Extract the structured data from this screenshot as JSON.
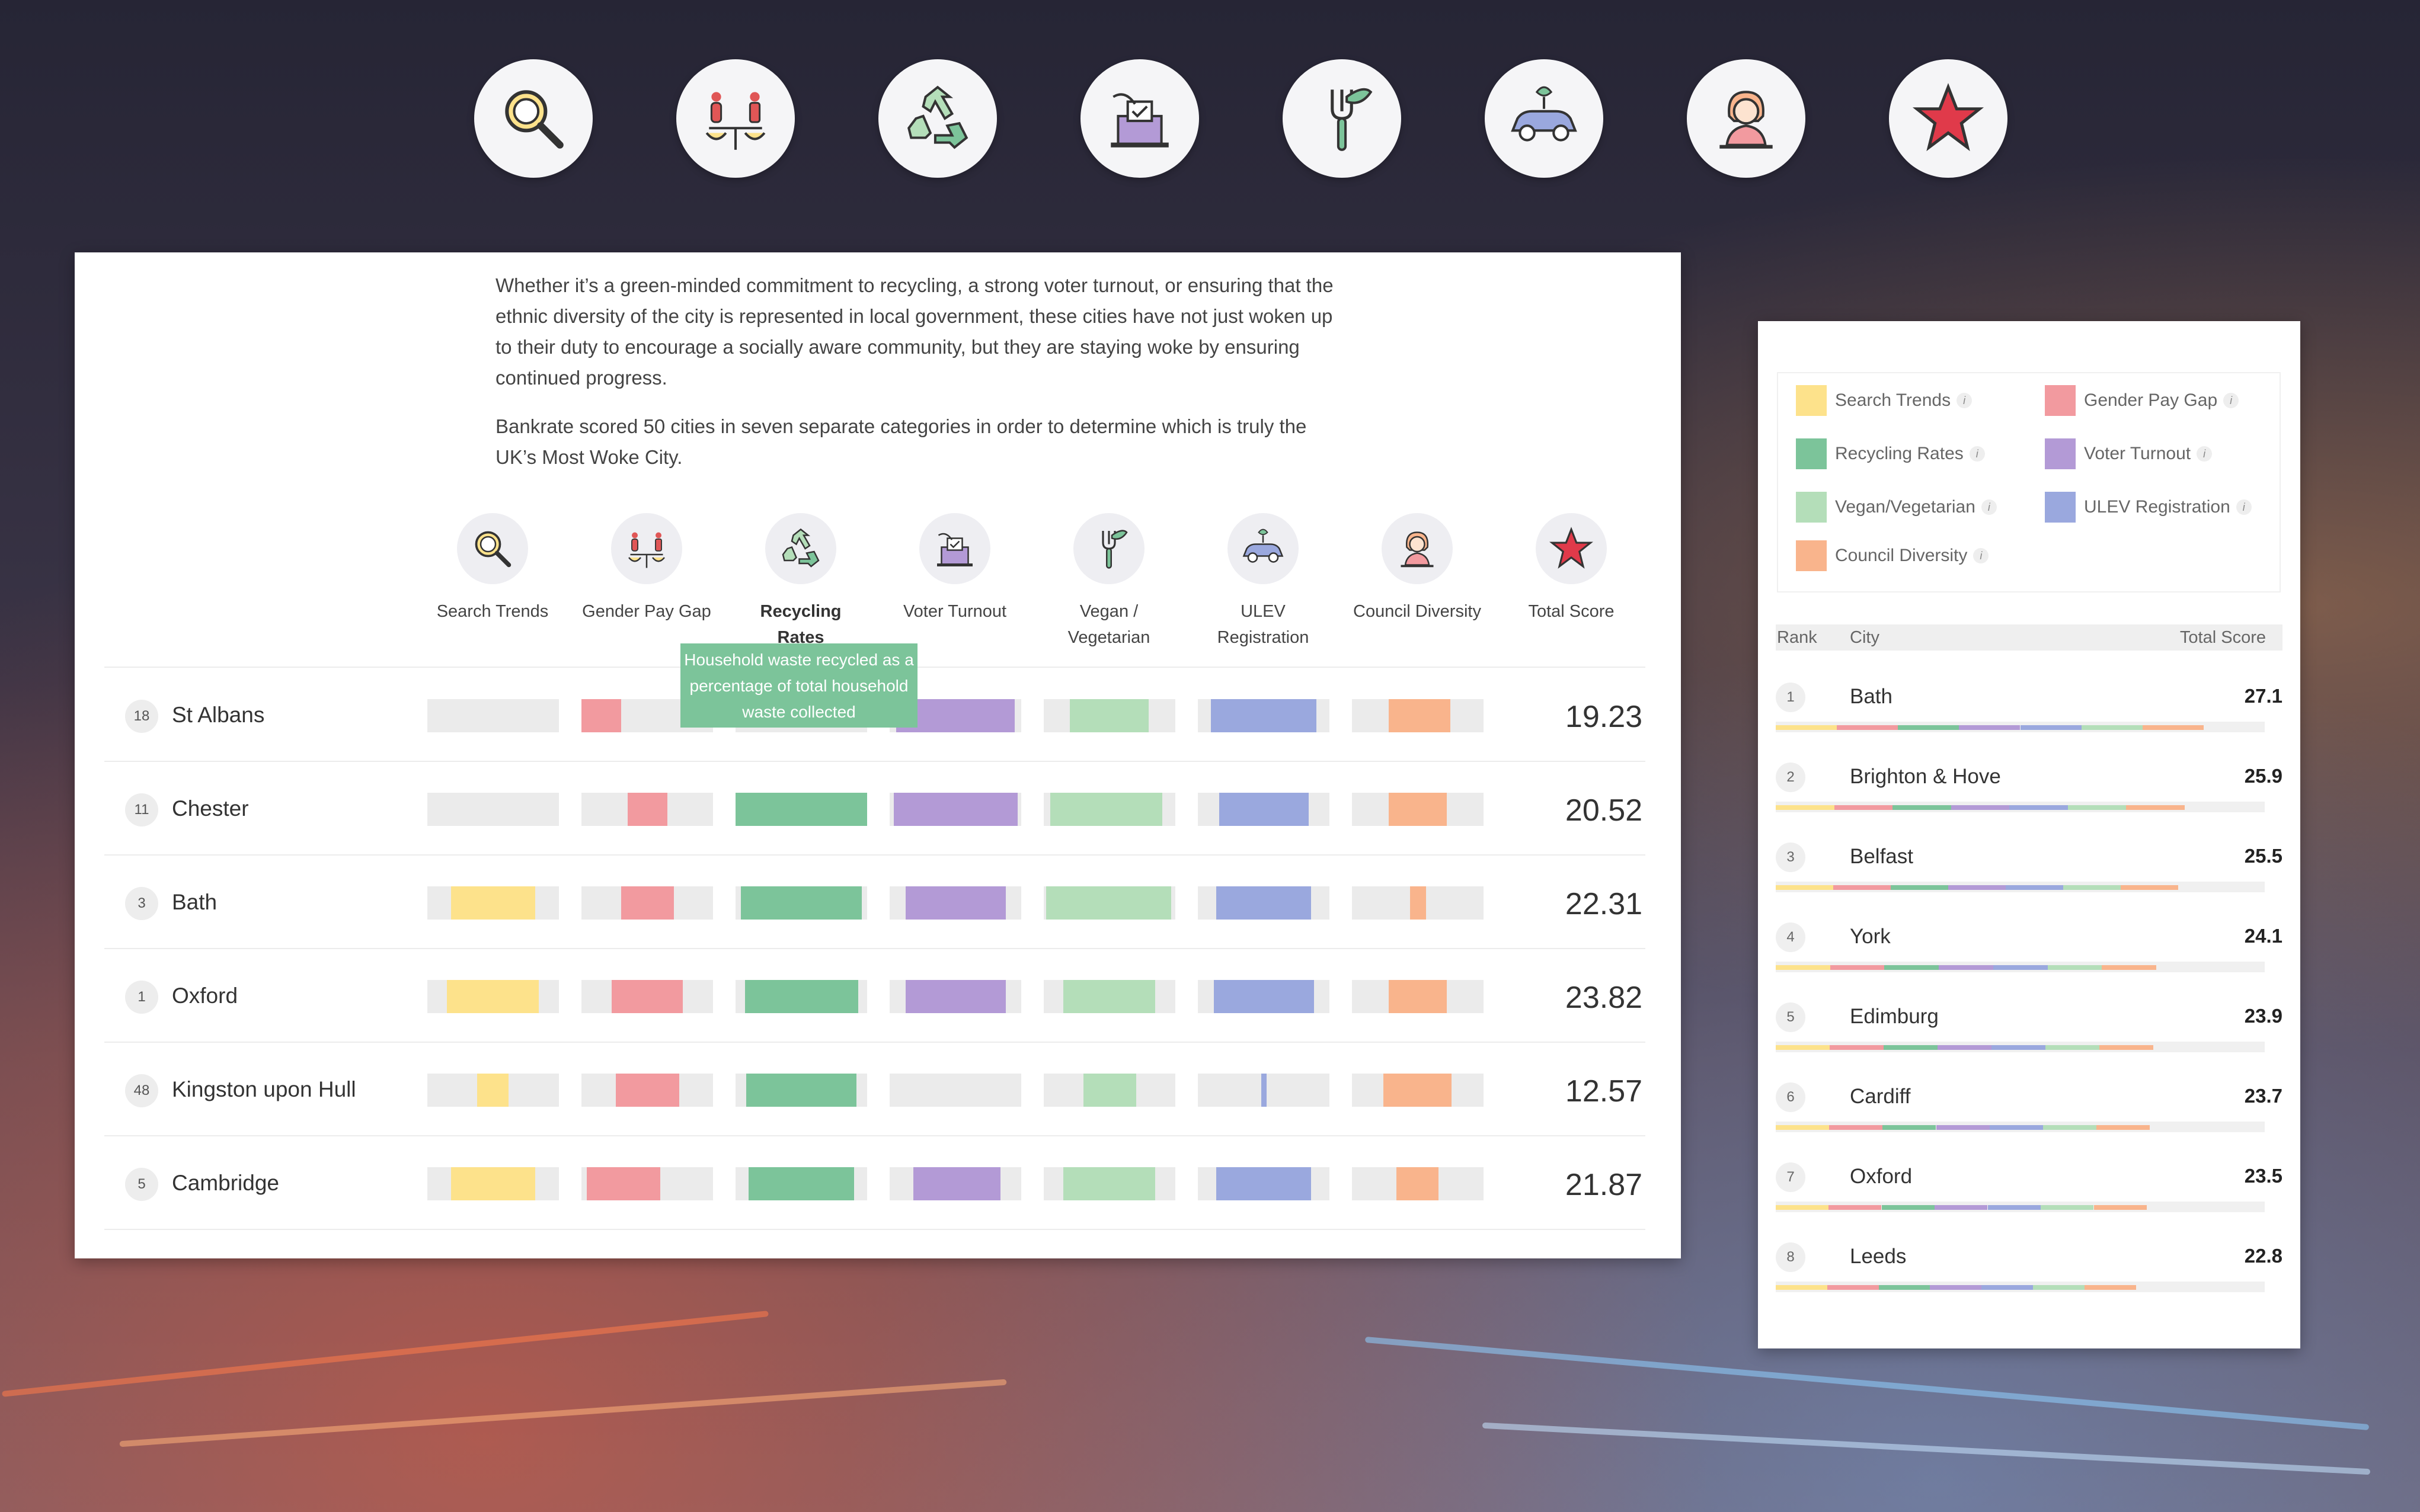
{
  "colors": {
    "search_trends": "#fde28b",
    "gender_pay_gap": "#f29a9f",
    "recycling_rates": "#7cc49a",
    "voter_turnout": "#b39ad6",
    "vegan_vegetarian": "#b4deb9",
    "ulev_registration": "#9aa8de",
    "council_diversity": "#f9b48c",
    "track": "#ebebeb"
  },
  "top_icons": [
    "search-icon",
    "gender-scale-icon",
    "recycle-icon",
    "ballot-box-icon",
    "fork-leaf-icon",
    "electric-car-icon",
    "councillor-icon",
    "star-icon"
  ],
  "intro": {
    "p1": "Whether it’s a green-minded commitment to recycling, a strong voter turnout, or ensuring that the ethnic diversity of the city is represented in local government, these cities have not just woken up to their duty to encourage a socially aware community, but they are staying woke by ensuring continued progress.",
    "p2": "Bankrate scored 50 cities in seven separate categories in order to determine which is truly the UK’s Most Woke City."
  },
  "categories": [
    {
      "key": "search_trends",
      "label": "Search Trends",
      "icon": "search-icon"
    },
    {
      "key": "gender_pay_gap",
      "label": "Gender Pay Gap",
      "icon": "gender-scale-icon"
    },
    {
      "key": "recycling_rates",
      "label": "Recycling Rates",
      "icon": "recycle-icon",
      "active": true
    },
    {
      "key": "voter_turnout",
      "label": "Voter Turnout",
      "icon": "ballot-box-icon"
    },
    {
      "key": "vegan_vegetarian",
      "label": "Vegan / Vegetarian",
      "icon": "fork-leaf-icon"
    },
    {
      "key": "ulev_registration",
      "label": "ULEV Registration",
      "icon": "electric-car-icon"
    },
    {
      "key": "council_diversity",
      "label": "Council Diversity",
      "icon": "councillor-icon"
    },
    {
      "key": "total_score",
      "label": "Total Score",
      "icon": "star-icon"
    }
  ],
  "tooltip": {
    "text": "Household waste recycled as a percentage of total household waste collected"
  },
  "rows": [
    {
      "rank": "18",
      "city": "St Albans",
      "score": "19.23",
      "bars": [
        [
          0,
          0
        ],
        [
          0,
          0.3
        ],
        [
          0,
          0
        ],
        [
          0.05,
          0.95
        ],
        [
          0.2,
          0.8
        ],
        [
          0.1,
          0.9
        ],
        [
          0.28,
          0.75
        ]
      ]
    },
    {
      "rank": "11",
      "city": "Chester",
      "score": "20.52",
      "bars": [
        [
          0,
          0
        ],
        [
          0.35,
          0.65
        ],
        [
          0,
          1
        ],
        [
          0.03,
          0.97
        ],
        [
          0.05,
          0.9
        ],
        [
          0.16,
          0.84
        ],
        [
          0.28,
          0.72
        ]
      ]
    },
    {
      "rank": "3",
      "city": "Bath",
      "score": "22.31",
      "bars": [
        [
          0.18,
          0.82
        ],
        [
          0.3,
          0.7
        ],
        [
          0.04,
          0.96
        ],
        [
          0.12,
          0.88
        ],
        [
          0.02,
          0.97
        ],
        [
          0.14,
          0.86
        ],
        [
          0.44,
          0.56
        ]
      ]
    },
    {
      "rank": "1",
      "city": "Oxford",
      "score": "23.82",
      "bars": [
        [
          0.15,
          0.85
        ],
        [
          0.23,
          0.77
        ],
        [
          0.07,
          0.93
        ],
        [
          0.12,
          0.88
        ],
        [
          0.15,
          0.85
        ],
        [
          0.12,
          0.88
        ],
        [
          0.28,
          0.72
        ]
      ]
    },
    {
      "rank": "48",
      "city": "Kingston upon Hull",
      "score": "12.57",
      "bars": [
        [
          0.38,
          0.62
        ],
        [
          0.26,
          0.74
        ],
        [
          0.08,
          0.92
        ],
        [
          0,
          0
        ],
        [
          0.3,
          0.7
        ],
        [
          0.48,
          0.52
        ],
        [
          0.24,
          0.76
        ]
      ]
    },
    {
      "rank": "5",
      "city": "Cambridge",
      "score": "21.87",
      "bars": [
        [
          0.18,
          0.82
        ],
        [
          0.04,
          0.6
        ],
        [
          0.1,
          0.9
        ],
        [
          0.18,
          0.84
        ],
        [
          0.15,
          0.85
        ],
        [
          0.14,
          0.86
        ],
        [
          0.34,
          0.66
        ]
      ]
    }
  ],
  "legend": [
    {
      "key": "search_trends",
      "label": "Search Trends"
    },
    {
      "key": "gender_pay_gap",
      "label": "Gender Pay Gap"
    },
    {
      "key": "recycling_rates",
      "label": "Recycling Rates"
    },
    {
      "key": "voter_turnout",
      "label": "Voter Turnout"
    },
    {
      "key": "vegan_vegetarian",
      "label": "Vegan/Vegetarian"
    },
    {
      "key": "ulev_registration",
      "label": "ULEV Registration"
    },
    {
      "key": "council_diversity",
      "label": "Council Diversity"
    }
  ],
  "ranking": {
    "headers": {
      "rank": "Rank",
      "city": "City",
      "total": "Total Score"
    },
    "max_score": 27.1,
    "items": [
      {
        "rank": "1",
        "city": "Bath",
        "score": "27.1"
      },
      {
        "rank": "2",
        "city": "Brighton & Hove",
        "score": "25.9"
      },
      {
        "rank": "3",
        "city": "Belfast",
        "score": "25.5"
      },
      {
        "rank": "4",
        "city": "York",
        "score": "24.1"
      },
      {
        "rank": "5",
        "city": "Edimburg",
        "score": "23.9"
      },
      {
        "rank": "6",
        "city": "Cardiff",
        "score": "23.7"
      },
      {
        "rank": "7",
        "city": "Oxford",
        "score": "23.5"
      },
      {
        "rank": "8",
        "city": "Leeds",
        "score": "22.8"
      }
    ]
  }
}
